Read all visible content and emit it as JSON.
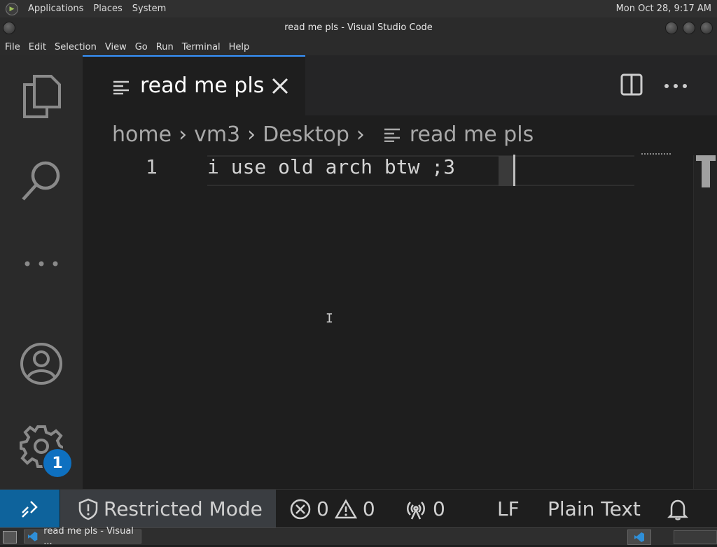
{
  "top_panel": {
    "menus": [
      "Applications",
      "Places",
      "System"
    ],
    "clock": "Mon Oct 28,  9:17 AM"
  },
  "window": {
    "title": "read me pls - Visual Studio Code"
  },
  "menubar": [
    "File",
    "Edit",
    "Selection",
    "View",
    "Go",
    "Run",
    "Terminal",
    "Help"
  ],
  "activity_bar": {
    "icons": [
      "explorer-icon",
      "search-icon",
      "more-icon",
      "accounts-icon",
      "settings-gear-icon"
    ],
    "settings_badge": "1"
  },
  "tab": {
    "label": "read me pls"
  },
  "breadcrumb": [
    "home",
    "vm3",
    "Desktop",
    "read me pls"
  ],
  "editor": {
    "line_numbers": [
      "1"
    ],
    "line_1": "i use old arch btw ;3"
  },
  "status_bar": {
    "restricted_mode": "Restricted Mode",
    "errors": "0",
    "warnings": "0",
    "ports": "0",
    "eol": "LF",
    "language": "Plain Text"
  },
  "taskbar": {
    "task_label": "read me pls - Visual ..."
  },
  "colors": {
    "accent": "#0e639c",
    "tab_border": "#3794ff",
    "badge": "#0e70c0"
  }
}
